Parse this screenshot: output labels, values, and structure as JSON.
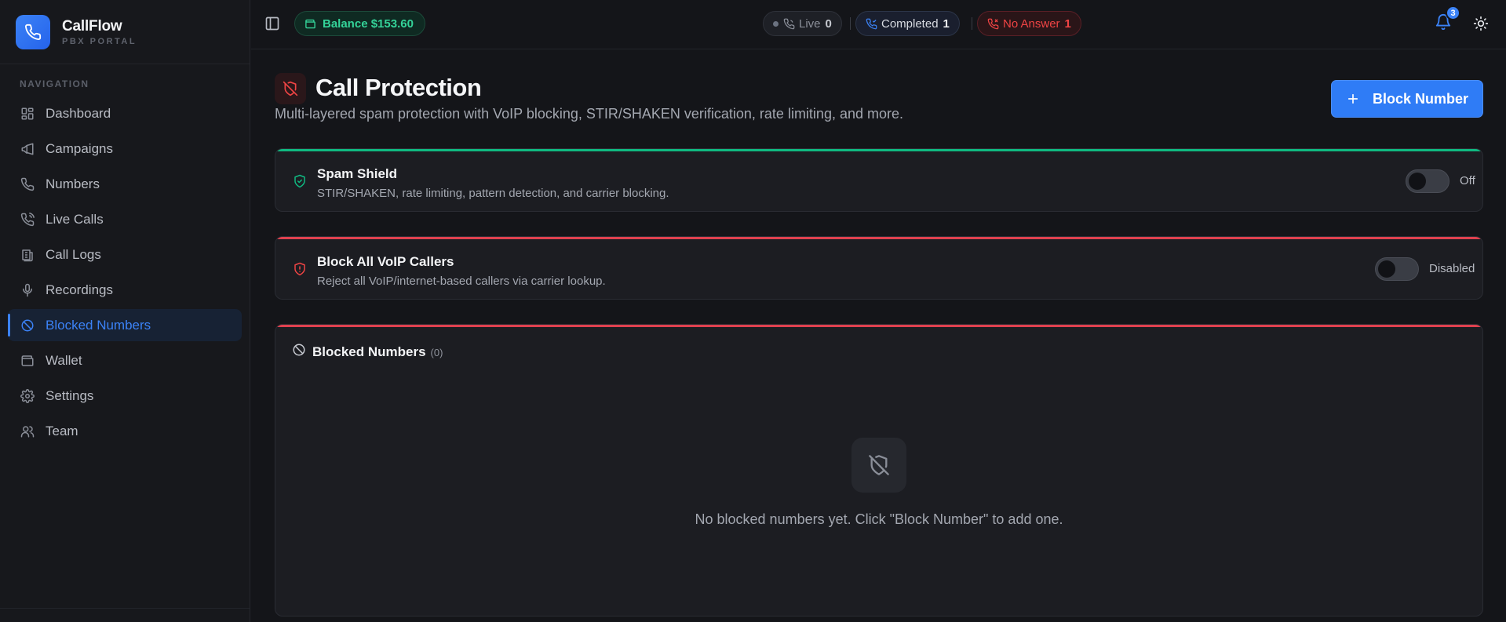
{
  "brand": {
    "name": "CallFlow",
    "subtitle": "PBX PORTAL",
    "accent": "#3b82f6"
  },
  "sidebar": {
    "heading": "NAVIGATION",
    "items": [
      {
        "label": "Dashboard",
        "icon": "dashboard-icon"
      },
      {
        "label": "Campaigns",
        "icon": "megaphone-icon"
      },
      {
        "label": "Numbers",
        "icon": "phone-icon"
      },
      {
        "label": "Live Calls",
        "icon": "phone-call-icon"
      },
      {
        "label": "Call Logs",
        "icon": "call-logs-icon"
      },
      {
        "label": "Recordings",
        "icon": "microphone-icon"
      },
      {
        "label": "Blocked Numbers",
        "icon": "ban-icon",
        "active": true
      },
      {
        "label": "Wallet",
        "icon": "wallet-icon"
      },
      {
        "label": "Settings",
        "icon": "gear-icon"
      },
      {
        "label": "Team",
        "icon": "users-icon"
      }
    ]
  },
  "topbar": {
    "balance_label": "Balance $153.60",
    "live": {
      "label": "Live",
      "count": "0"
    },
    "completed": {
      "label": "Completed",
      "count": "1"
    },
    "no_answer": {
      "label": "No Answer",
      "count": "1"
    },
    "notifications_count": "3"
  },
  "page": {
    "title": "Call Protection",
    "subtitle": "Multi-layered spam protection with VoIP blocking, STIR/SHAKEN verification, rate limiting, and more.",
    "block_button": "Block Number"
  },
  "spam_shield": {
    "title": "Spam Shield",
    "description": "STIR/SHAKEN, rate limiting, pattern detection, and carrier blocking.",
    "state": "Off",
    "accent": "#10b981"
  },
  "voip": {
    "title": "Block All VoIP Callers",
    "description": "Reject all VoIP/internet-based callers via carrier lookup.",
    "state": "Disabled",
    "accent": "#e0414f"
  },
  "blocked_numbers": {
    "title": "Blocked Numbers",
    "count": "(0)",
    "empty_message": "No blocked numbers yet. Click \"Block Number\" to add one."
  }
}
